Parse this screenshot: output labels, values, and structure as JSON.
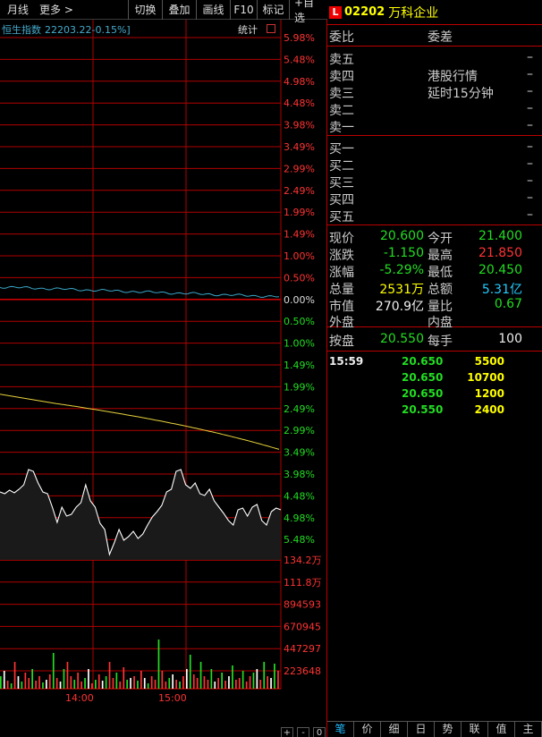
{
  "toolbar": {
    "period": "月线",
    "more": "更多 >",
    "buttons": [
      "切换",
      "叠加",
      "画线",
      "F10",
      "标记",
      "+自选"
    ]
  },
  "index": {
    "name": "恒生指数",
    "value": "22203.22-0.15%]",
    "stat_label": "统计"
  },
  "axis": {
    "pct_labels_up": [
      "5.98%",
      "5.48%",
      "4.98%",
      "4.48%",
      "3.98%",
      "3.49%",
      "2.99%",
      "2.49%",
      "1.99%",
      "1.49%",
      "1.00%",
      "0.50%"
    ],
    "zero_label": "0.00%",
    "pct_labels_down": [
      "0.50%",
      "1.00%",
      "1.49%",
      "1.99%",
      "2.49%",
      "2.99%",
      "3.49%",
      "3.98%",
      "4.48%",
      "4.98%",
      "5.48%"
    ],
    "vol_labels": [
      "134.2万",
      "111.8万",
      "894593",
      "670945",
      "447297",
      "223648"
    ],
    "time_labels": [
      "14:00",
      "15:00"
    ]
  },
  "controls": [
    "+",
    "-",
    "0"
  ],
  "stock": {
    "tag": "L",
    "code": "02202",
    "name": "万科企业"
  },
  "ratio": {
    "label": "委比",
    "diff_label": "委差"
  },
  "sell": [
    {
      "label": "卖五",
      "value": "–"
    },
    {
      "label": "卖四",
      "value": "–"
    },
    {
      "label": "卖三",
      "value": "–"
    },
    {
      "label": "卖二",
      "value": "–"
    },
    {
      "label": "卖一",
      "value": "–"
    }
  ],
  "notice": [
    "港股行情",
    "延时15分钟"
  ],
  "buy": [
    {
      "label": "买一",
      "value": "–"
    },
    {
      "label": "买二",
      "value": "–"
    },
    {
      "label": "买三",
      "value": "–"
    },
    {
      "label": "买四",
      "value": "–"
    },
    {
      "label": "买五",
      "value": "–"
    }
  ],
  "quote": {
    "now_label": "现价",
    "now": "20.600",
    "open_label": "今开",
    "open": "21.400",
    "chg_label": "涨跌",
    "chg": "-1.150",
    "high_label": "最高",
    "high": "21.850",
    "pct_label": "涨幅",
    "pct": "-5.29%",
    "low_label": "最低",
    "low": "20.450",
    "vol_label": "总量",
    "vol": "2531万",
    "amt_label": "总额",
    "amt": "5.31亿",
    "cap_label": "市值",
    "cap": "270.9亿",
    "vr_label": "量比",
    "vr": "0.67",
    "out_label": "外盘",
    "in_label": "内盘"
  },
  "lot": {
    "bid_label": "按盘",
    "bid": "20.550",
    "lot_label": "每手",
    "lot": "100"
  },
  "ticks": [
    {
      "time": "15:59",
      "price": "20.650",
      "vol": "5500"
    },
    {
      "time": "",
      "price": "20.650",
      "vol": "10700"
    },
    {
      "time": "",
      "price": "20.650",
      "vol": "1200"
    },
    {
      "time": "",
      "price": "20.550",
      "vol": "2400"
    }
  ],
  "tabs": [
    "笔",
    "价",
    "细",
    "日",
    "势",
    "联",
    "值",
    "主"
  ],
  "colors": {
    "grid_red": "#b00000",
    "index_line": "#3aa6c8",
    "avg_line": "#e6d23c",
    "price_line": "#ffffff"
  }
}
